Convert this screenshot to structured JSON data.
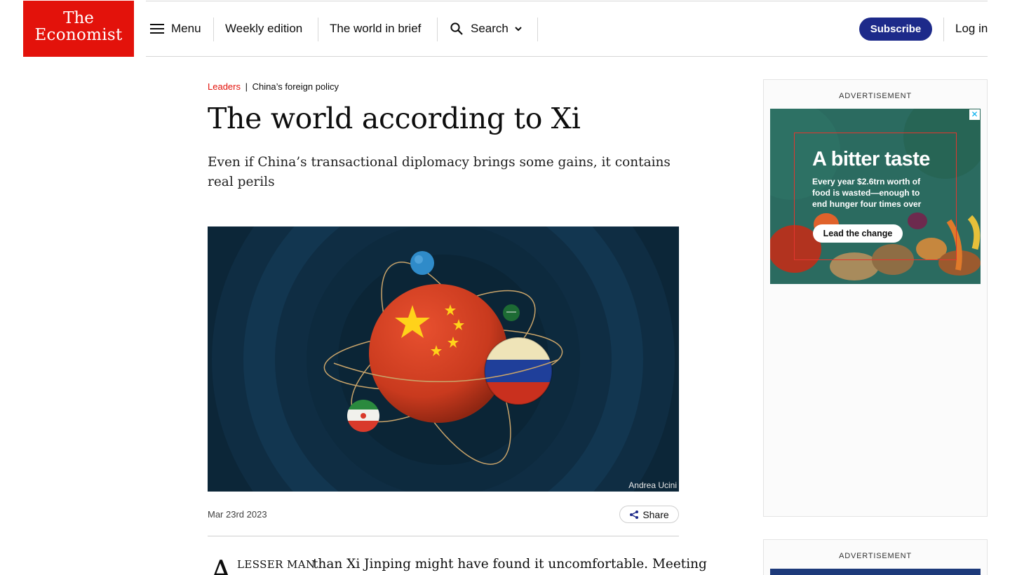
{
  "brand": {
    "logo_line1": "The",
    "logo_line2": "Economist"
  },
  "nav": {
    "menu_label": "Menu",
    "weekly_edition": "Weekly edition",
    "world_in_brief": "The world in brief",
    "search_label": "Search",
    "subscribe_label": "Subscribe",
    "login_label": "Log in"
  },
  "article": {
    "section": "Leaders",
    "divider": "|",
    "topic": "China’s foreign policy",
    "headline": "The world according to Xi",
    "subheadline": "Even if China’s transactional diplomacy brings some gains, it contains real perils",
    "image_credit": "Andrea Ucini",
    "date": "Mar 23rd 2023",
    "share_label": "Share",
    "drop_cap": "A",
    "opening_small_caps": "LESSER MAN",
    "opening_text": "than Xi Jinping might have found it uncomfortable. Meeting"
  },
  "ads": {
    "label": "ADVERTISEMENT",
    "ad1": {
      "close_glyph": "✕",
      "title": "A bitter taste",
      "text": "Every year $2.6trn worth of food is wasted—enough to end hunger four times over",
      "cta": "Lead the change"
    },
    "ad2": {}
  },
  "colors": {
    "brand_red": "#e3120b",
    "subscribe_blue": "#1d2a8a",
    "hero_background": "#0d2a3e",
    "ad_background": "#2a6a5f"
  },
  "icons": [
    "menu-icon",
    "search-icon",
    "chevron-down-icon",
    "share-icon",
    "close-icon"
  ]
}
